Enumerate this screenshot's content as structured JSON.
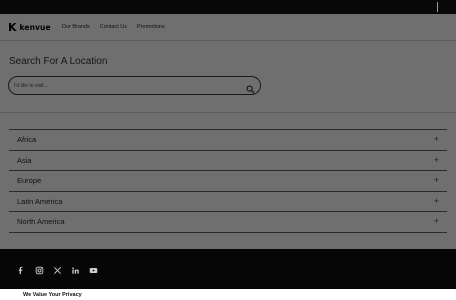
{
  "brand": {
    "logo_mark": "K",
    "logo_text": "kenvue"
  },
  "nav": {
    "links": [
      "Our Brands",
      "Contact Us",
      "Promotions"
    ]
  },
  "search": {
    "heading": "Search For A Location",
    "placeholder": "I'd like to visit...",
    "icon": "search-icon"
  },
  "regions": [
    {
      "label": "Africa",
      "icon": "+"
    },
    {
      "label": "Asia",
      "icon": "+"
    },
    {
      "label": "Europe",
      "icon": "+"
    },
    {
      "label": "Latin America",
      "icon": "+"
    },
    {
      "label": "North America",
      "icon": "+"
    }
  ],
  "footer": {
    "social": [
      "facebook-icon",
      "instagram-icon",
      "x-icon",
      "linkedin-icon",
      "youtube-icon"
    ]
  },
  "privacy": {
    "title": "We Value Your Privacy"
  },
  "colors": {
    "overlay": "#6f6f6f",
    "topbar": "#080808",
    "footer": "#060606",
    "banner": "#ffffff"
  }
}
